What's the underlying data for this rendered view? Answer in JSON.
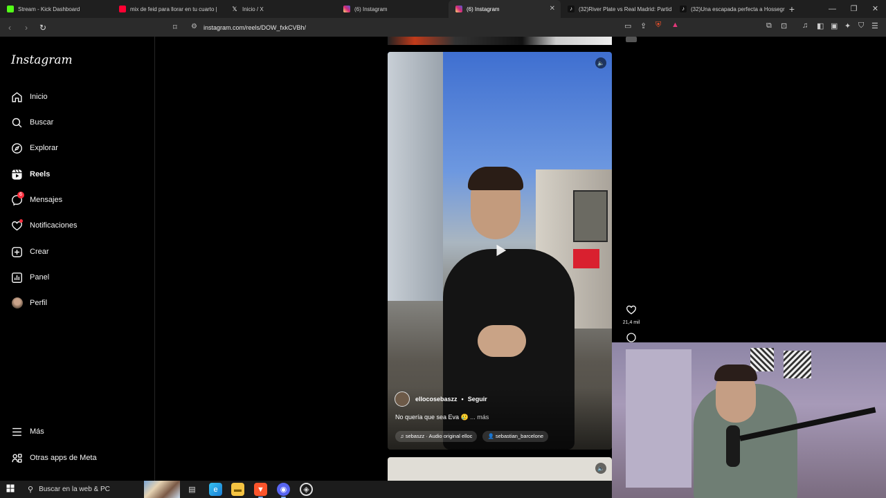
{
  "browser": {
    "tabs": [
      {
        "title": "Stream - Kick Dashboard",
        "favicon_color": "#53fc18"
      },
      {
        "title": "mix de feid para llorar en tu cuarto |",
        "favicon_color": "#ff0033"
      },
      {
        "title": "Inicio / X",
        "favicon_color": "#ffffff"
      },
      {
        "title": "(6) Instagram",
        "favicon_color": "#dd2a7b"
      },
      {
        "title": "(6) Instagram",
        "favicon_color": "#dd2a7b",
        "active": true
      },
      {
        "title": "(32)River Plate vs Real Madrid: Partid",
        "favicon_color": "#25f4ee"
      },
      {
        "title": "(32)Una escapada perfecta a Hossegr",
        "favicon_color": "#25f4ee"
      }
    ],
    "url": "instagram.com/reels/DOW_fxkCVBh/"
  },
  "sidebar": {
    "logo": "Instagram",
    "items": [
      {
        "label": "Inicio",
        "icon": "home-icon"
      },
      {
        "label": "Buscar",
        "icon": "search-icon"
      },
      {
        "label": "Explorar",
        "icon": "compass-icon"
      },
      {
        "label": "Reels",
        "icon": "reels-icon",
        "active": true
      },
      {
        "label": "Mensajes",
        "icon": "messenger-icon",
        "badge": "6"
      },
      {
        "label": "Notificaciones",
        "icon": "heart-icon",
        "dot": true
      },
      {
        "label": "Crear",
        "icon": "plus-icon"
      },
      {
        "label": "Panel",
        "icon": "dashboard-icon"
      },
      {
        "label": "Perfil",
        "icon": "avatar-icon"
      }
    ],
    "bottom_items": [
      {
        "label": "Más",
        "icon": "menu-icon"
      },
      {
        "label": "Otras apps de Meta",
        "icon": "meta-apps-icon"
      }
    ]
  },
  "reel": {
    "username": "ellocosebaszz",
    "separator": "•",
    "follow_label": "Seguir",
    "caption": "No quería que sea Eva 🥲",
    "more_label": "... más",
    "audio_label": "♫ sebaszz · Audio original  elloc",
    "tagged_user": "sebastian_barcelone"
  },
  "actions": {
    "like_count": "21,4 mil"
  },
  "taskbar": {
    "search_placeholder": "Buscar en la web & PC"
  },
  "colors": {
    "accent_badge": "#ff3040",
    "sidebar_bg": "#000000",
    "browser_bg": "#2b2b2b"
  }
}
